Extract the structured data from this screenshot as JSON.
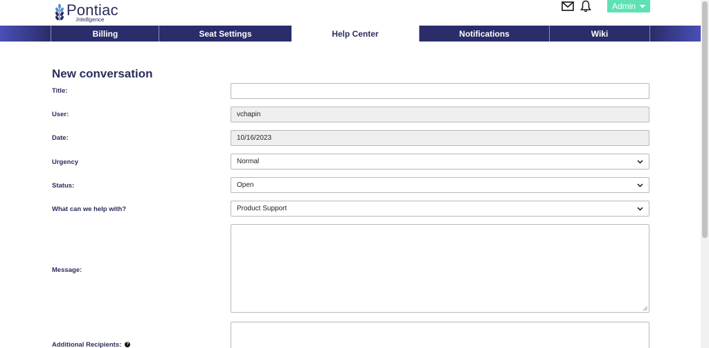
{
  "brand": {
    "name": "Pontiac",
    "tagline": "Intelligence"
  },
  "header": {
    "admin_label": "Admin"
  },
  "nav": {
    "tabs": [
      {
        "label": "Billing"
      },
      {
        "label": "Seat Settings"
      },
      {
        "label": "Help Center"
      },
      {
        "label": "Notifications"
      },
      {
        "label": "Wiki"
      }
    ]
  },
  "form": {
    "title": "New conversation",
    "title_label": "Title:",
    "title_value": "",
    "user_label": "User:",
    "user_value": "vchapin",
    "date_label": "Date:",
    "date_value": "10/16/2023",
    "urgency_label": "Urgency",
    "urgency_value": "Normal",
    "status_label": "Status:",
    "status_value": "Open",
    "help_label": "What can we help with?",
    "help_value": "Product Support",
    "message_label": "Message:",
    "recipients_label": "Additional Recipients:"
  },
  "colors": {
    "navy": "#2a2d6a",
    "accent": "#5fe1b3"
  }
}
